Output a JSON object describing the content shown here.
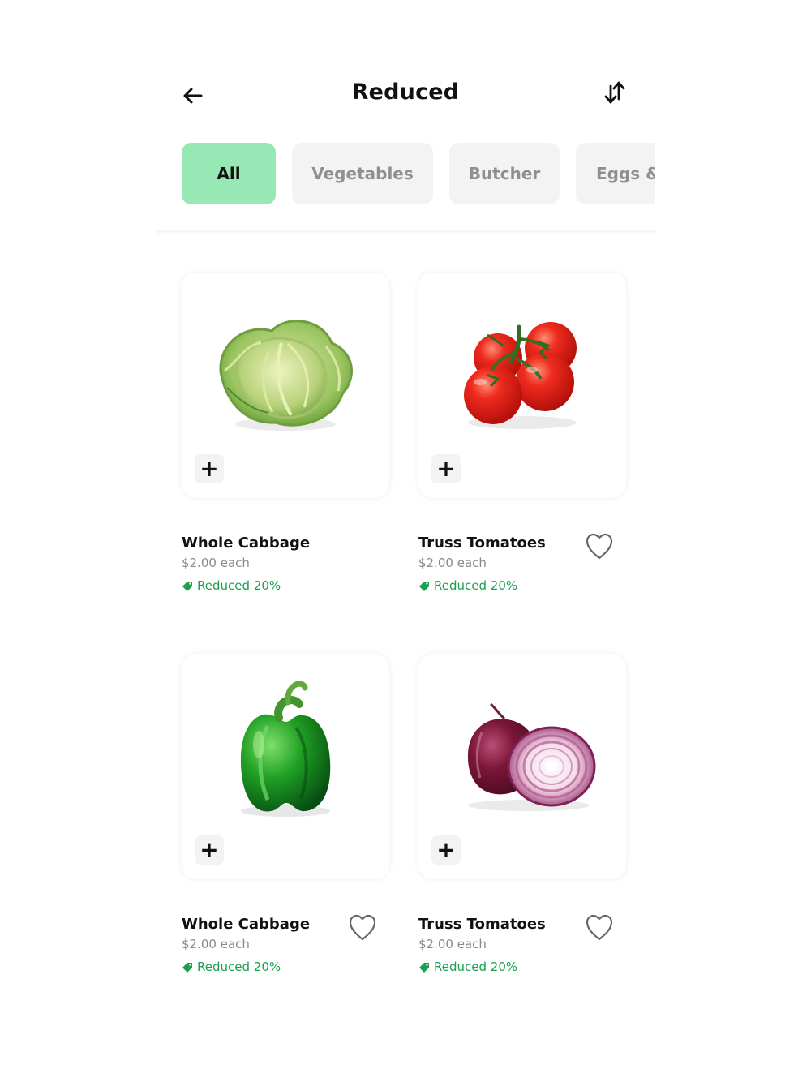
{
  "header": {
    "title": "Reduced",
    "back_icon": "arrow-left-icon",
    "sort_icon": "sort-arrows-icon"
  },
  "filters": {
    "chips": [
      {
        "label": "All",
        "active": true
      },
      {
        "label": "Vegetables",
        "active": false
      },
      {
        "label": "Butcher",
        "active": false
      },
      {
        "label": "Eggs &",
        "active": false
      }
    ]
  },
  "products": [
    {
      "name": "Whole Cabbage",
      "price": "$2.00 each",
      "reduced": "Reduced 20%",
      "image": "cabbage",
      "show_favorite": false
    },
    {
      "name": "Truss Tomatoes",
      "price": "$2.00 each",
      "reduced": "Reduced 20%",
      "image": "tomatoes",
      "show_favorite": true
    },
    {
      "name": "Whole Cabbage",
      "price": "$2.00 each",
      "reduced": "Reduced 20%",
      "image": "bell-pepper",
      "show_favorite": true
    },
    {
      "name": "Truss Tomatoes",
      "price": "$2.00 each",
      "reduced": "Reduced 20%",
      "image": "red-onion",
      "show_favorite": true
    }
  ],
  "buttons": {
    "add": "+"
  },
  "colors": {
    "active_chip": "#98e8b5",
    "inactive_chip": "#f3f3f3",
    "reduced_text": "#1aa150",
    "price_text": "#8a8a8a"
  }
}
